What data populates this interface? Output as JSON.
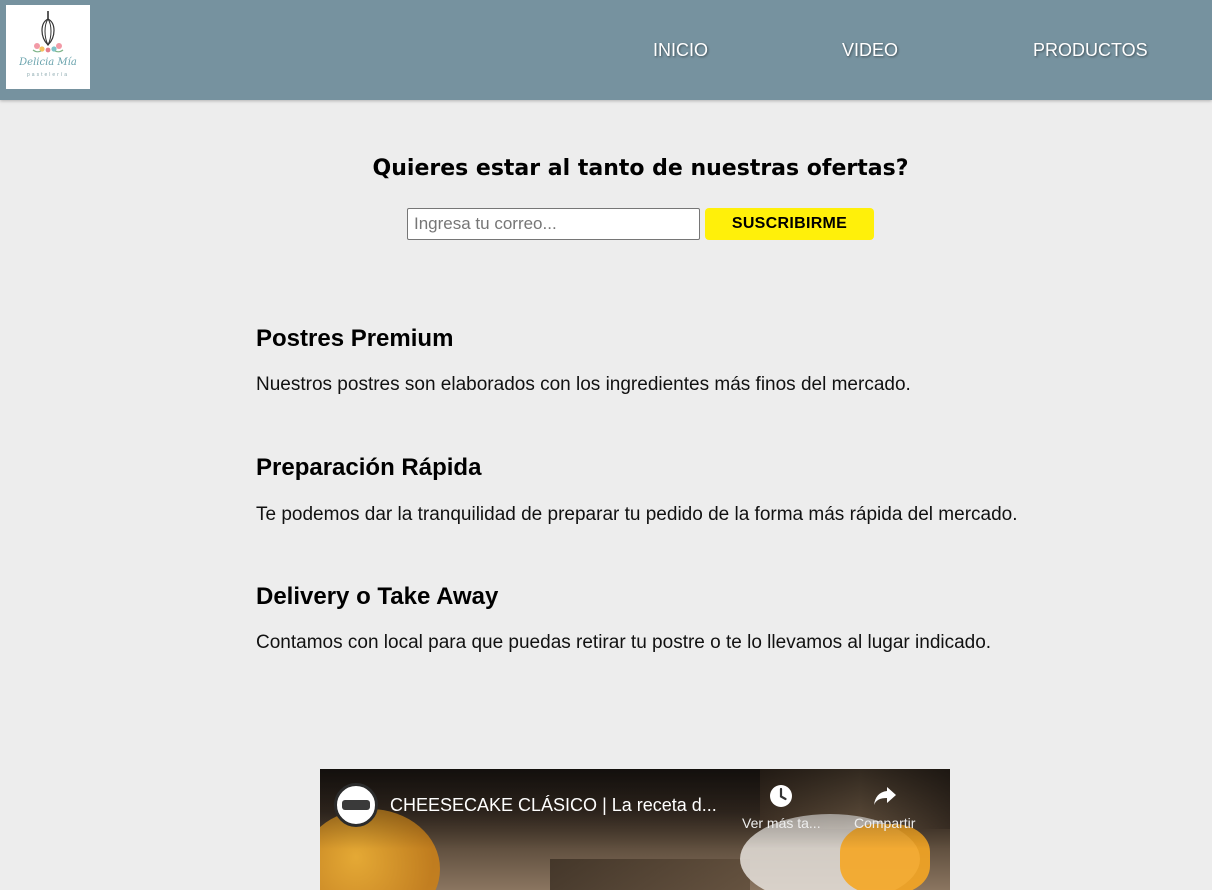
{
  "header": {
    "logo": {
      "name": "Delicia Mía",
      "tagline": "pastelería"
    },
    "nav": [
      {
        "label": "INICIO"
      },
      {
        "label": "VIDEO"
      },
      {
        "label": "PRODUCTOS"
      }
    ],
    "background_color": "#76929f"
  },
  "subscribe": {
    "title": "Quieres estar al tanto de nuestras ofertas?",
    "email_placeholder": "Ingresa tu correo...",
    "email_value": "",
    "button_label": "SUSCRIBIRME",
    "button_color": "#fff00a"
  },
  "features": [
    {
      "title": "Postres Premium",
      "description": "Nuestros postres son elaborados con los ingredientes más finos del mercado."
    },
    {
      "title": "Preparación Rápida",
      "description": "Te podemos dar la tranquilidad de preparar tu pedido de la forma más rápida del mercado."
    },
    {
      "title": "Delivery o Take Away",
      "description": "Contamos con local para que puedas retirar tu postre o te lo llevamos al lugar indicado."
    }
  ],
  "video": {
    "title": "CHEESECAKE CLÁSICO | La receta d...",
    "watch_later_label": "Ver más ta...",
    "share_label": "Compartir",
    "watch_later_icon": "clock-icon",
    "share_icon": "share-arrow-icon"
  }
}
